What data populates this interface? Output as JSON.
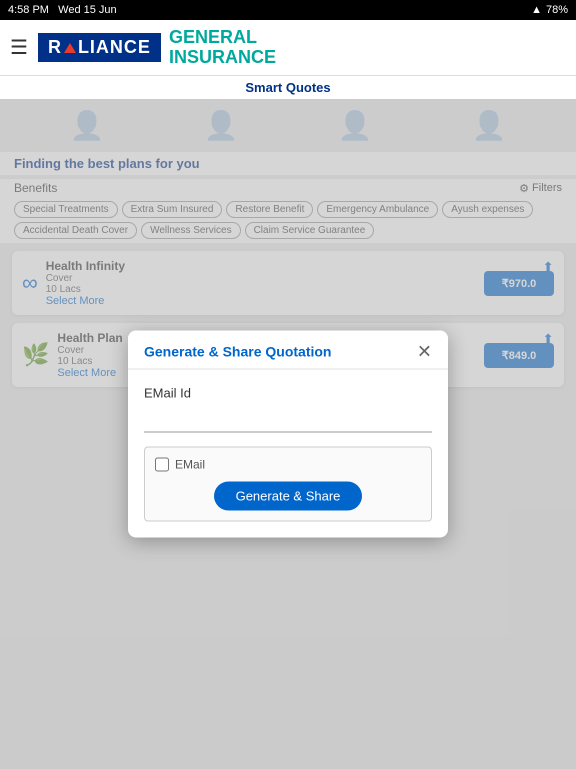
{
  "statusBar": {
    "time": "4:58 PM",
    "date": "Wed 15 Jun",
    "battery": "78%"
  },
  "header": {
    "hamburgerLabel": "☰",
    "relianceText": "RELIANCE",
    "generalInsuranceText": "GENERAL\nINSURANCE",
    "smartQuotes": "Smart Quotes"
  },
  "main": {
    "findingText": "Finding the best plans for you",
    "benefitsLabel": "Benefits",
    "filtersLabel": "Filters",
    "tags": [
      "Special Treatments",
      "Extra Sum Insured",
      "Restore Benefit",
      "Emergency Ambulance",
      "Ayush expenses",
      "Accidental Death Cover",
      "Wellness Services",
      "Claim Service Guarantee"
    ],
    "cards": [
      {
        "icon": "∞",
        "title": "Health Infinity",
        "coverLabel": "Cover",
        "coverValue": "10 Lacs",
        "selectMore": "Select More",
        "price": "₹970.0"
      },
      {
        "icon": "🌿",
        "title": "Health Plan",
        "coverLabel": "Cover",
        "coverValue": "10 Lacs",
        "selectMore": "Select More",
        "price": "₹849.0"
      }
    ]
  },
  "modal": {
    "title": "Generate & Share Quotation",
    "closeLabel": "✕",
    "emailIdLabel": "EMail Id",
    "emailPlaceholder": "EMail",
    "generateBtnLabel": "Generate & Share"
  }
}
